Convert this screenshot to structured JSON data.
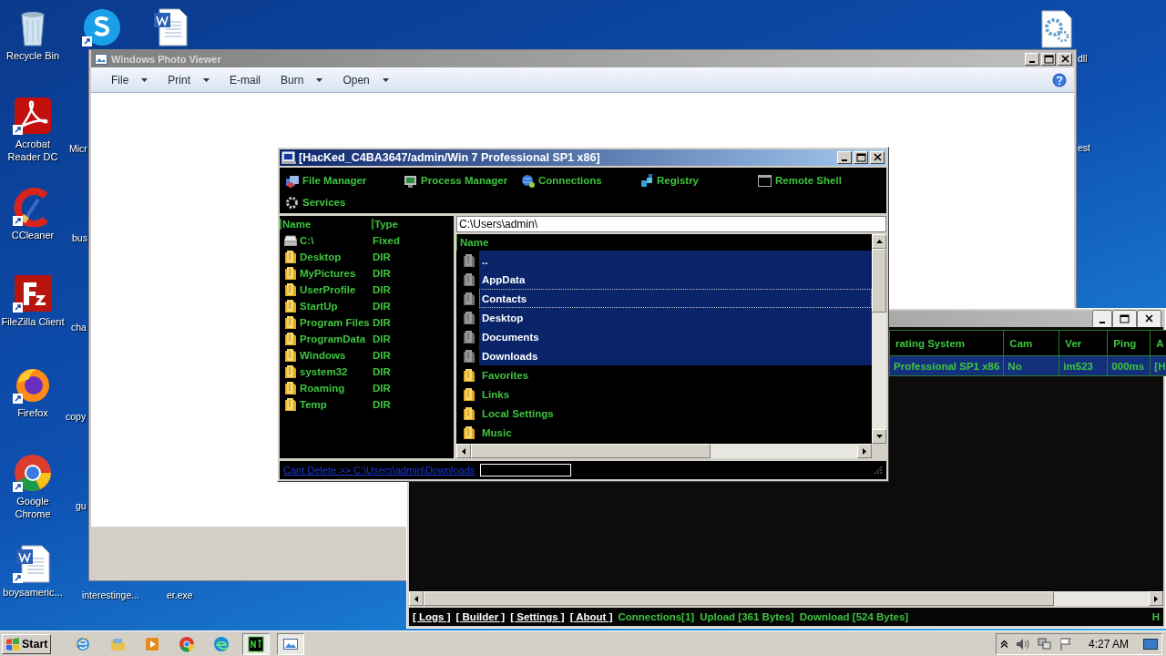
{
  "desktop": {
    "icons": [
      {
        "kind": "recycle",
        "label": "Recycle Bin"
      },
      {
        "kind": "acrobat",
        "label": "Acrobat Reader DC"
      },
      {
        "kind": "ccleaner",
        "label": "CCleaner"
      },
      {
        "kind": "filezilla",
        "label": "FileZilla Client"
      },
      {
        "kind": "firefox",
        "label": "Firefox"
      },
      {
        "kind": "chrome",
        "label": "Google Chrome"
      },
      {
        "kind": "word",
        "label": "boysameric..."
      },
      {
        "kind": "skype"
      },
      {
        "kind": "word"
      },
      {
        "kind": "gear"
      }
    ],
    "partial_labels": [
      "Micr",
      "bus",
      "cha",
      "copy",
      "gu",
      "interestinge...",
      "er.exe",
      "dll",
      "est"
    ]
  },
  "photo_viewer": {
    "title": "Windows Photo Viewer",
    "menu": [
      {
        "label": "File",
        "dropdown": true
      },
      {
        "label": "Print",
        "dropdown": true
      },
      {
        "label": "E-mail",
        "dropdown": false
      },
      {
        "label": "Burn",
        "dropdown": true
      },
      {
        "label": "Open",
        "dropdown": true
      }
    ]
  },
  "main_window": {
    "columns": [
      "rating System",
      "Cam",
      "Ver",
      "Ping",
      "A"
    ],
    "rows": [
      {
        "cells": [
          "Professional SP1 x86",
          "No",
          "im523",
          "000ms",
          "[H"
        ],
        "selected": true
      }
    ],
    "links": [
      "[ Logs ]",
      "[ Builder ]",
      "[ Settings ]",
      "[ About ]"
    ],
    "stats": [
      "Connections[1]",
      "Upload [361 Bytes]",
      "Download [524 Bytes]"
    ],
    "status_end": "H"
  },
  "file_manager": {
    "title": "[HacKed_C4BA3647/admin/Win 7 Professional SP1 x86]",
    "tools": [
      {
        "kind": "files",
        "label": "File Manager"
      },
      {
        "kind": "process",
        "label": "Process Manager"
      },
      {
        "kind": "connections",
        "label": "Connections"
      },
      {
        "kind": "registry",
        "label": "Registry"
      },
      {
        "kind": "shell",
        "label": "Remote Shell"
      },
      {
        "kind": "services",
        "label": "Services"
      }
    ],
    "drives_columns": [
      "Name",
      "Type"
    ],
    "drives": [
      {
        "kind": "drive",
        "name": "C:\\",
        "type": "Fixed"
      },
      {
        "kind": "folder",
        "name": "Desktop",
        "type": "DIR"
      },
      {
        "kind": "folder",
        "name": "MyPictures",
        "type": "DIR"
      },
      {
        "kind": "folder",
        "name": "UserProfile",
        "type": "DIR"
      },
      {
        "kind": "folder",
        "name": "StartUp",
        "type": "DIR"
      },
      {
        "kind": "folder",
        "name": "Program Files",
        "type": "DIR"
      },
      {
        "kind": "folder",
        "name": "ProgramData",
        "type": "DIR"
      },
      {
        "kind": "folder",
        "name": "Windows",
        "type": "DIR"
      },
      {
        "kind": "folder",
        "name": "system32",
        "type": "DIR"
      },
      {
        "kind": "folder",
        "name": "Roaming",
        "type": "DIR"
      },
      {
        "kind": "folder",
        "name": "Temp",
        "type": "DIR"
      }
    ],
    "path": "C:\\Users\\admin\\",
    "files_column": "Name",
    "files": [
      {
        "name": "..",
        "selected": true,
        "focused": false
      },
      {
        "name": "AppData",
        "selected": true,
        "focused": false
      },
      {
        "name": "Contacts",
        "selected": true,
        "focused": true
      },
      {
        "name": "Desktop",
        "selected": true,
        "focused": false
      },
      {
        "name": "Documents",
        "selected": true,
        "focused": false
      },
      {
        "name": "Downloads",
        "selected": true,
        "focused": false
      },
      {
        "name": "Favorites",
        "selected": false,
        "focused": false
      },
      {
        "name": "Links",
        "selected": false,
        "focused": false
      },
      {
        "name": "Local Settings",
        "selected": false,
        "focused": false
      },
      {
        "name": "Music",
        "selected": false,
        "focused": false
      }
    ],
    "status_link": "Cant Delete >> C:\\Users\\admin\\Downloads"
  },
  "taskbar": {
    "start": "Start",
    "apps": [
      {
        "kind": "ie",
        "active": false
      },
      {
        "kind": "explorer",
        "active": false
      },
      {
        "kind": "media",
        "active": false
      },
      {
        "kind": "chrome",
        "active": false
      },
      {
        "kind": "edge",
        "active": false
      },
      {
        "kind": "rat",
        "active": true
      },
      {
        "kind": "photo",
        "active": true
      }
    ],
    "clock": "4:27 AM"
  }
}
